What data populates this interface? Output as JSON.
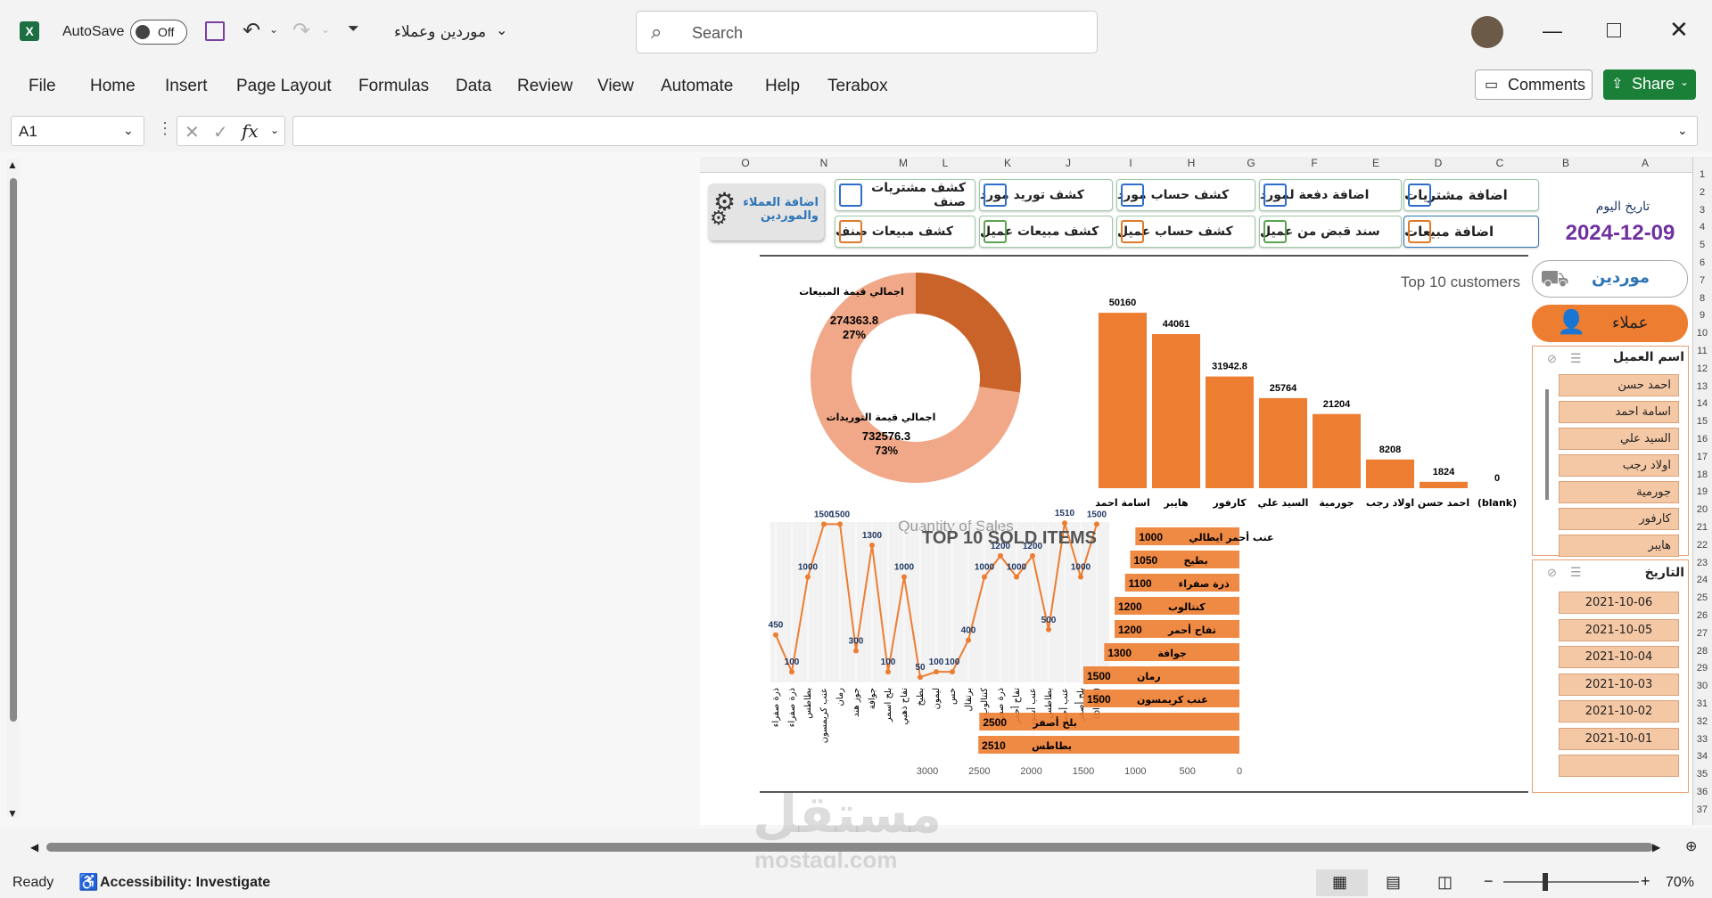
{
  "titlebar": {
    "autosave_label": "AutoSave",
    "autosave_state": "Off",
    "filename": "موردين وعملاء",
    "search_placeholder": "Search"
  },
  "menu": [
    "File",
    "Home",
    "Insert",
    "Page Layout",
    "Formulas",
    "Data",
    "Review",
    "View",
    "Automate",
    "Help",
    "Terabox"
  ],
  "ribbon_right": {
    "comments": "Comments",
    "share": "Share"
  },
  "formula_bar": {
    "name_box": "A1",
    "fx": "fx",
    "value": ""
  },
  "columns": [
    "O",
    "N",
    "M",
    "L",
    "K",
    "J",
    "I",
    "H",
    "G",
    "F",
    "E",
    "D",
    "C",
    "B",
    "A"
  ],
  "rows": [
    "1",
    "2",
    "3",
    "4",
    "5",
    "6",
    "7",
    "8",
    "9",
    "10",
    "11",
    "12",
    "13",
    "14",
    "15",
    "16",
    "17",
    "18",
    "19",
    "20",
    "21",
    "22",
    "23",
    "24",
    "25",
    "26",
    "27",
    "28",
    "29",
    "30",
    "31",
    "32",
    "33",
    "34",
    "35",
    "36",
    "37"
  ],
  "buttons": {
    "add_customers_suppliers": "اضافة العملاء والموردين",
    "item_purchases_statement": "كشف مشتريات صنف",
    "item_sales_statement": "كشف مبيعات صنف",
    "supplier_supply_statement": "كشف توريد مورد",
    "customer_sales_statement": "كشف مبيعات عميل",
    "supplier_account_statement": "كشف حساب مورد",
    "customer_account_statement": "كشف حساب عميل",
    "supplier_payment": "اضافة دفعة لمورد",
    "customer_receipt": "سند قبض من عميل",
    "add_purchases": "اضافة مشتريات",
    "add_sales": "اضافة مبيعات"
  },
  "date_block": {
    "label": "تاريخ اليوم",
    "value": "2024-12-09"
  },
  "side_tabs": {
    "suppliers": "موردين",
    "customers": "عملاء"
  },
  "slicer_customer": {
    "title": "اسم العميل",
    "items": [
      "احمد حسن",
      "اسامة احمد",
      "السيد علي",
      "اولاد رجب",
      "جورمية",
      "كارفور",
      "هايبر"
    ]
  },
  "slicer_date": {
    "title": "التاريخ",
    "items": [
      "2021-10-06",
      "2021-10-05",
      "2021-10-04",
      "2021-10-03",
      "2021-10-02",
      "2021-10-01",
      ""
    ]
  },
  "chart_data": [
    {
      "type": "pie",
      "donut": true,
      "labels": [
        "اجمالي قيمة المبيعات",
        "اجمالي قيمة التوريدات"
      ],
      "values": [
        274363.8,
        732576.3
      ],
      "percent_labels": [
        "27%",
        "73%"
      ],
      "value_labels": [
        "274363.8",
        "732576.3"
      ],
      "colors": [
        "#c9632a",
        "#f0a888"
      ]
    },
    {
      "type": "bar",
      "title": "Top 10 customers",
      "categories": [
        "اسامة احمد",
        "هايبر",
        "كارفور",
        "السيد علي",
        "جورمية",
        "اولاد رجب",
        "احمد حسن",
        "(blank)"
      ],
      "values": [
        50160,
        44061,
        31942.8,
        25764,
        21204,
        8208,
        1824,
        0
      ],
      "value_labels": [
        "50160",
        "44061",
        "31942.8",
        "25764",
        "21204",
        "8208",
        "1824",
        "0"
      ],
      "color": "#ed7d31"
    },
    {
      "type": "line",
      "title": "Quantity of Sales",
      "values": [
        450,
        100,
        1000,
        1500,
        1500,
        300,
        1300,
        100,
        1000,
        50,
        100,
        100,
        400,
        1000,
        1200,
        1000,
        1200,
        500,
        1510,
        1000,
        1500
      ],
      "value_labels": [
        "450",
        "100",
        "1000",
        "1500",
        "1500",
        "300",
        "1300",
        "100",
        "1000",
        "50",
        "100",
        "100",
        "400",
        "1000",
        "1200",
        "1000",
        "1200",
        "500",
        "1510",
        "1000",
        "1500"
      ],
      "categories": [
        "ذرة صفراء",
        "ذرة صفراء",
        "بطاطس",
        "عنب كريمسون",
        "رمان",
        "جوز هند",
        "جوافة",
        "بلح اسمر",
        "تفاح ذهبي",
        "بطيخ",
        "ليمون",
        "خس",
        "برتقال",
        "كنتالوب",
        "ذرة صفراء",
        "تفاح أحمر",
        "عنب أسود",
        "بطاطس",
        "عنب أحمر",
        "بلح أصفر",
        "(blank)"
      ],
      "color": "#ed7d31"
    },
    {
      "type": "bar",
      "orientation": "horizontal",
      "title": "TOP 10 SOLD ITEMS",
      "categories": [
        "عنب أحمر ايطالي",
        "بطيخ",
        "ذرة صفراء",
        "كنتالوب",
        "تفاح أحمر",
        "جوافة",
        "رمان",
        "عنب كريمسون",
        "بلح أصفر",
        "بطاطس"
      ],
      "values": [
        1000,
        1050,
        1100,
        1200,
        1200,
        1300,
        1500,
        1500,
        2500,
        2510
      ],
      "value_labels": [
        "1000",
        "1050",
        "1100",
        "1200",
        "1200",
        "1300",
        "1500",
        "1500",
        "2500",
        "2510"
      ],
      "x_ticks": [
        "3000",
        "2500",
        "2000",
        "1500",
        "1000",
        "500",
        "0"
      ],
      "xlim": [
        0,
        3000
      ],
      "color": "#ed7d31"
    }
  ],
  "statusbar": {
    "ready": "Ready",
    "accessibility": "Accessibility: Investigate",
    "zoom": "70%"
  },
  "watermark": {
    "arabic": "مستقل",
    "latin": "mostaql.com"
  }
}
